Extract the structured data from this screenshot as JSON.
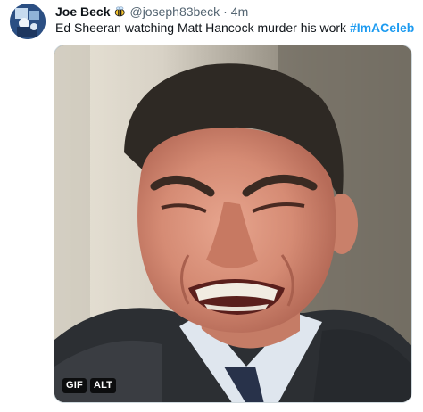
{
  "tweet": {
    "author": {
      "display_name": "Joe Beck",
      "badge_icon": "bee-emoji-icon",
      "handle": "@joseph83beck",
      "separator": "·",
      "timestamp": "4m"
    },
    "text_prefix": "Ed Sheeran watching Matt Hancock murder his work ",
    "hashtag": "#ImACeleb",
    "media": {
      "type": "gif",
      "gif_badge": "GIF",
      "alt_badge": "ALT"
    }
  },
  "colors": {
    "link": "#1d9bf0",
    "secondary_text": "#536471",
    "primary_text": "#0f1419"
  }
}
